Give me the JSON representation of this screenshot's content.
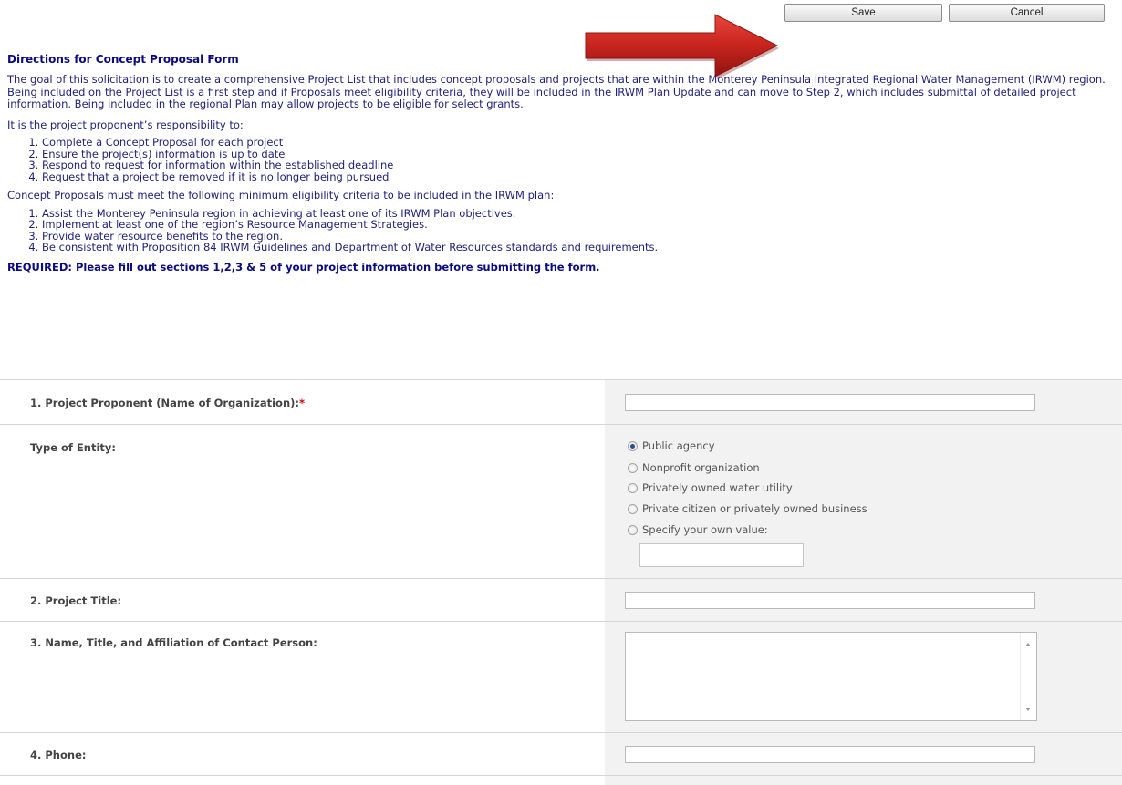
{
  "toolbar": {
    "save_label": "Save",
    "cancel_label": "Cancel"
  },
  "annotation": {
    "arrow_icon": "red-arrow-pointing-right",
    "arrow_color": "#c8241e"
  },
  "directions": {
    "title": "Directions for Concept Proposal Form",
    "intro": "The goal of this solicitation is to create a comprehensive Project List that includes concept proposals and projects that are within the Monterey Peninsula Integrated Regional Water Management (IRWM) region. Being included on the Project List is a first step and if Proposals meet eligibility criteria, they will be included in the IRWM Plan Update and can move to Step 2, which includes submittal of detailed project information. Being included in the regional Plan may allow projects to be eligible for select grants.",
    "responsibility_heading": "It is the project proponent’s responsibility to:",
    "responsibilities": [
      "Complete a Concept Proposal for each project",
      "Ensure the project(s) information is up to date",
      "Respond to request for information within the established deadline",
      "Request that a project be removed if it is no longer being pursued"
    ],
    "criteria_heading": "Concept Proposals must meet the following minimum eligibility criteria to be included in the IRWM plan:",
    "criteria": [
      "Assist the Monterey Peninsula region in achieving at least one of its IRWM Plan objectives.",
      "Implement at least one of the region’s Resource Management Strategies.",
      "Provide water resource benefits to the region.",
      "Be consistent with Proposition 84 IRWM Guidelines and Department of Water Resources standards and requirements."
    ],
    "required_note": "REQUIRED: Please fill out sections 1,2,3 & 5 of your project information before submitting the form."
  },
  "form": {
    "proponent": {
      "label": "1. Project Proponent (Name of Organization):",
      "required_mark": "*",
      "value": ""
    },
    "entity": {
      "label": "Type of Entity:",
      "options": [
        "Public agency",
        "Nonprofit organization",
        "Privately owned water utility",
        "Private citizen or privately owned business",
        "Specify your own value:"
      ],
      "selected": "Public agency",
      "own_value": ""
    },
    "title": {
      "label": "2. Project Title:",
      "value": ""
    },
    "contact": {
      "label": "3. Name, Title, and Affiliation of Contact Person:",
      "value": ""
    },
    "phone": {
      "label": "4. Phone:",
      "value": ""
    }
  }
}
